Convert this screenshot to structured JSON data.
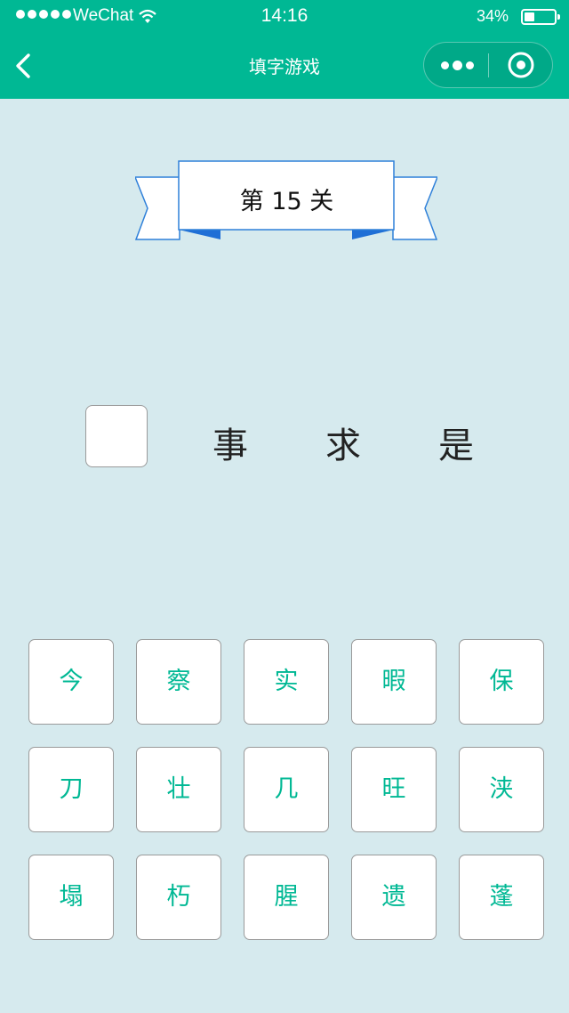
{
  "status_bar": {
    "carrier": "WeChat",
    "time": "14:16",
    "battery_pct": "34%",
    "battery_level": 0.34
  },
  "nav": {
    "back_icon": "chevron-left-icon",
    "title": "填字游戏",
    "more_icon": "more-dots-icon",
    "close_icon": "target-icon"
  },
  "level": {
    "title": "第 15 关"
  },
  "puzzle": {
    "blank": "",
    "chars": [
      "事",
      "求",
      "是"
    ]
  },
  "options": [
    "今",
    "察",
    "实",
    "暇",
    "保",
    "刀",
    "壮",
    "几",
    "旺",
    "浃",
    "塌",
    "朽",
    "腥",
    "遗",
    "蓬"
  ],
  "colors": {
    "brand": "#00b894",
    "background": "#d6eaee",
    "ribbon_edge": "#2f80d9"
  }
}
